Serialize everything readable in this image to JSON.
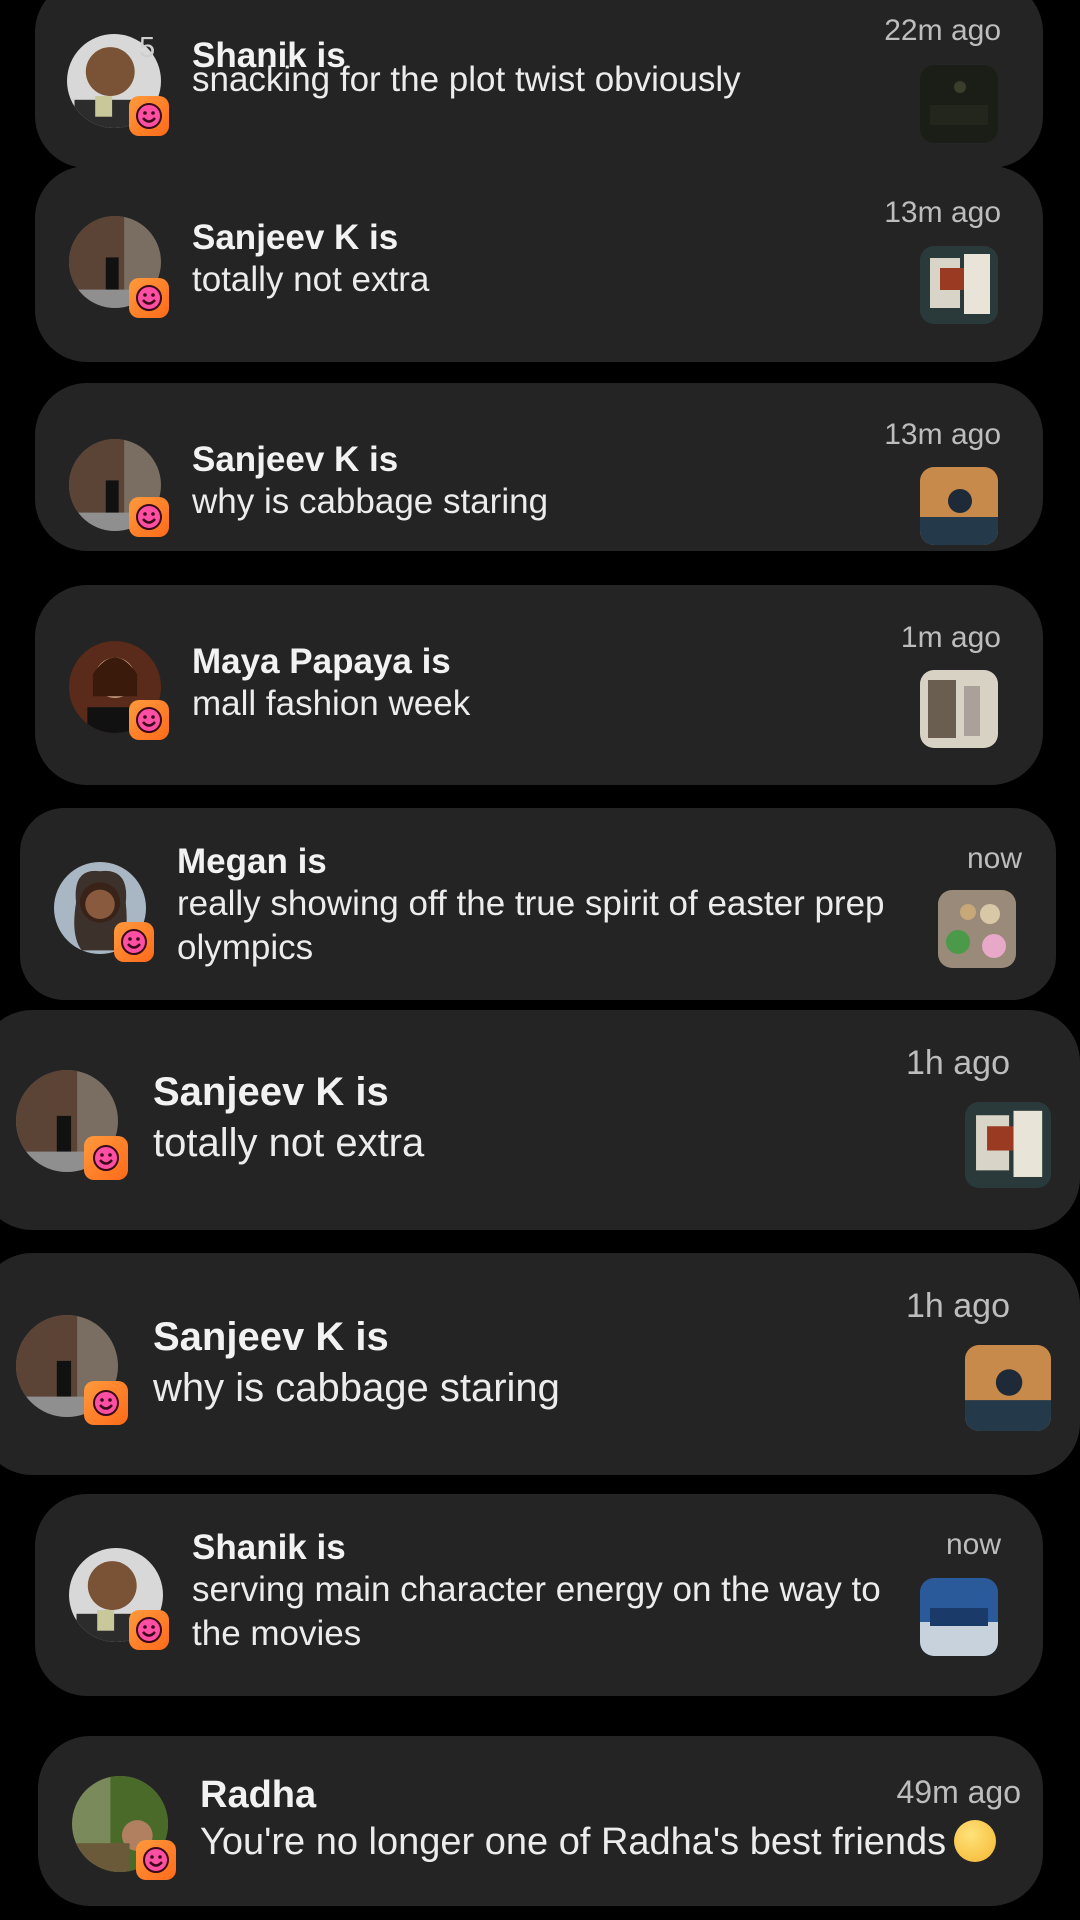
{
  "notifications": [
    {
      "title": "Shanik is",
      "message": "snacking for the plot twist obviously",
      "time": "22m ago",
      "count": "5"
    },
    {
      "title": "Sanjeev K is",
      "message": "totally not extra",
      "time": "13m ago"
    },
    {
      "title": "Sanjeev K is",
      "message": "why is cabbage staring",
      "time": "13m ago"
    },
    {
      "title": "Maya Papaya is",
      "message": "mall fashion week",
      "time": "1m ago"
    },
    {
      "title": "Megan is",
      "message": "really showing off the true spirit of easter prep olympics",
      "time": "now"
    },
    {
      "title": "Sanjeev K is",
      "message": "totally not extra",
      "time": "1h ago"
    },
    {
      "title": "Sanjeev K is",
      "message": "why is cabbage staring",
      "time": "1h ago"
    },
    {
      "title": "Shanik is",
      "message": "serving main character energy on the way to the movies",
      "time": "now"
    },
    {
      "title": "Radha",
      "message": "You're no longer one of Radha's best friends",
      "time": "49m ago",
      "emoji_icon": "pensive-face-icon"
    }
  ],
  "colors": {
    "card": "#242424",
    "badge": "#ff7a1f",
    "background": "#000000"
  }
}
